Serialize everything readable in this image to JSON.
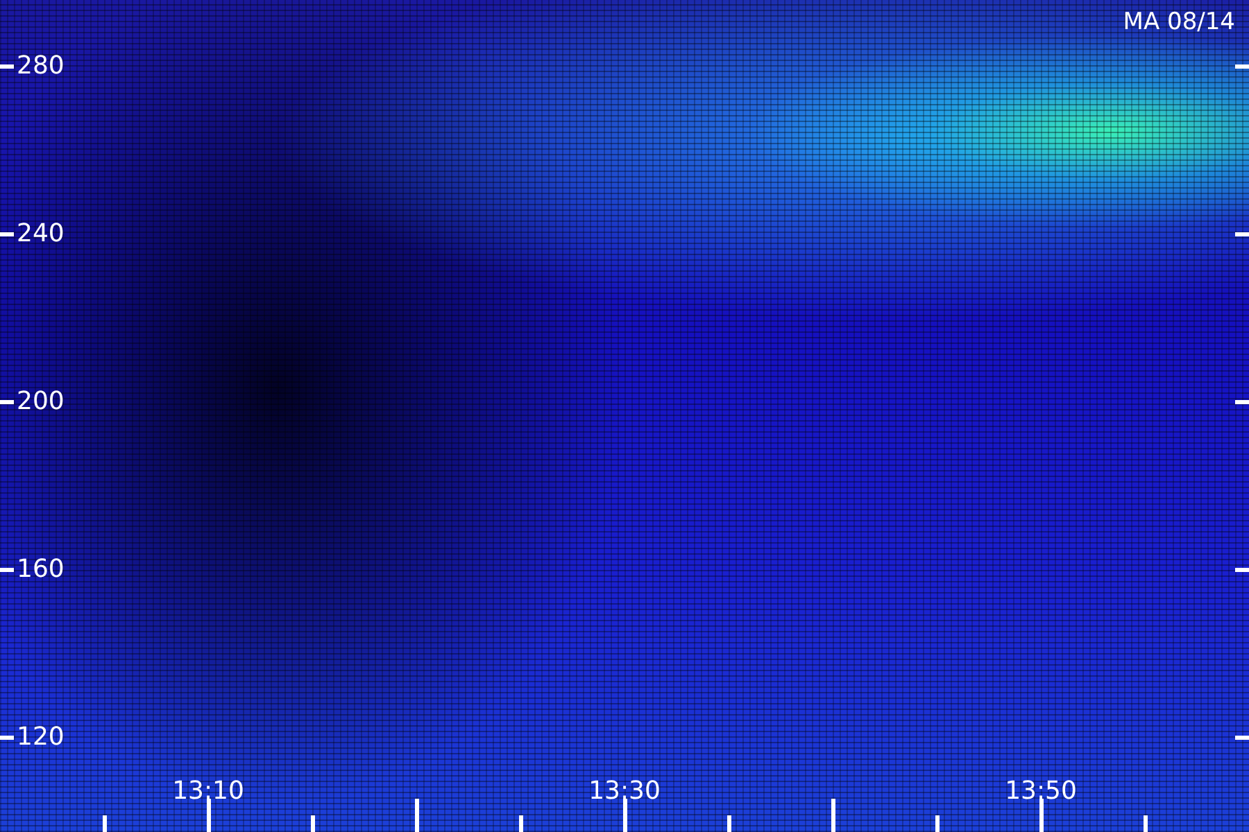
{
  "title": "MA 08/14",
  "y_labels": [
    "280",
    "240",
    "200",
    "160",
    "120"
  ],
  "x_labels": [
    "13:10",
    "13:30",
    "13:50"
  ]
}
